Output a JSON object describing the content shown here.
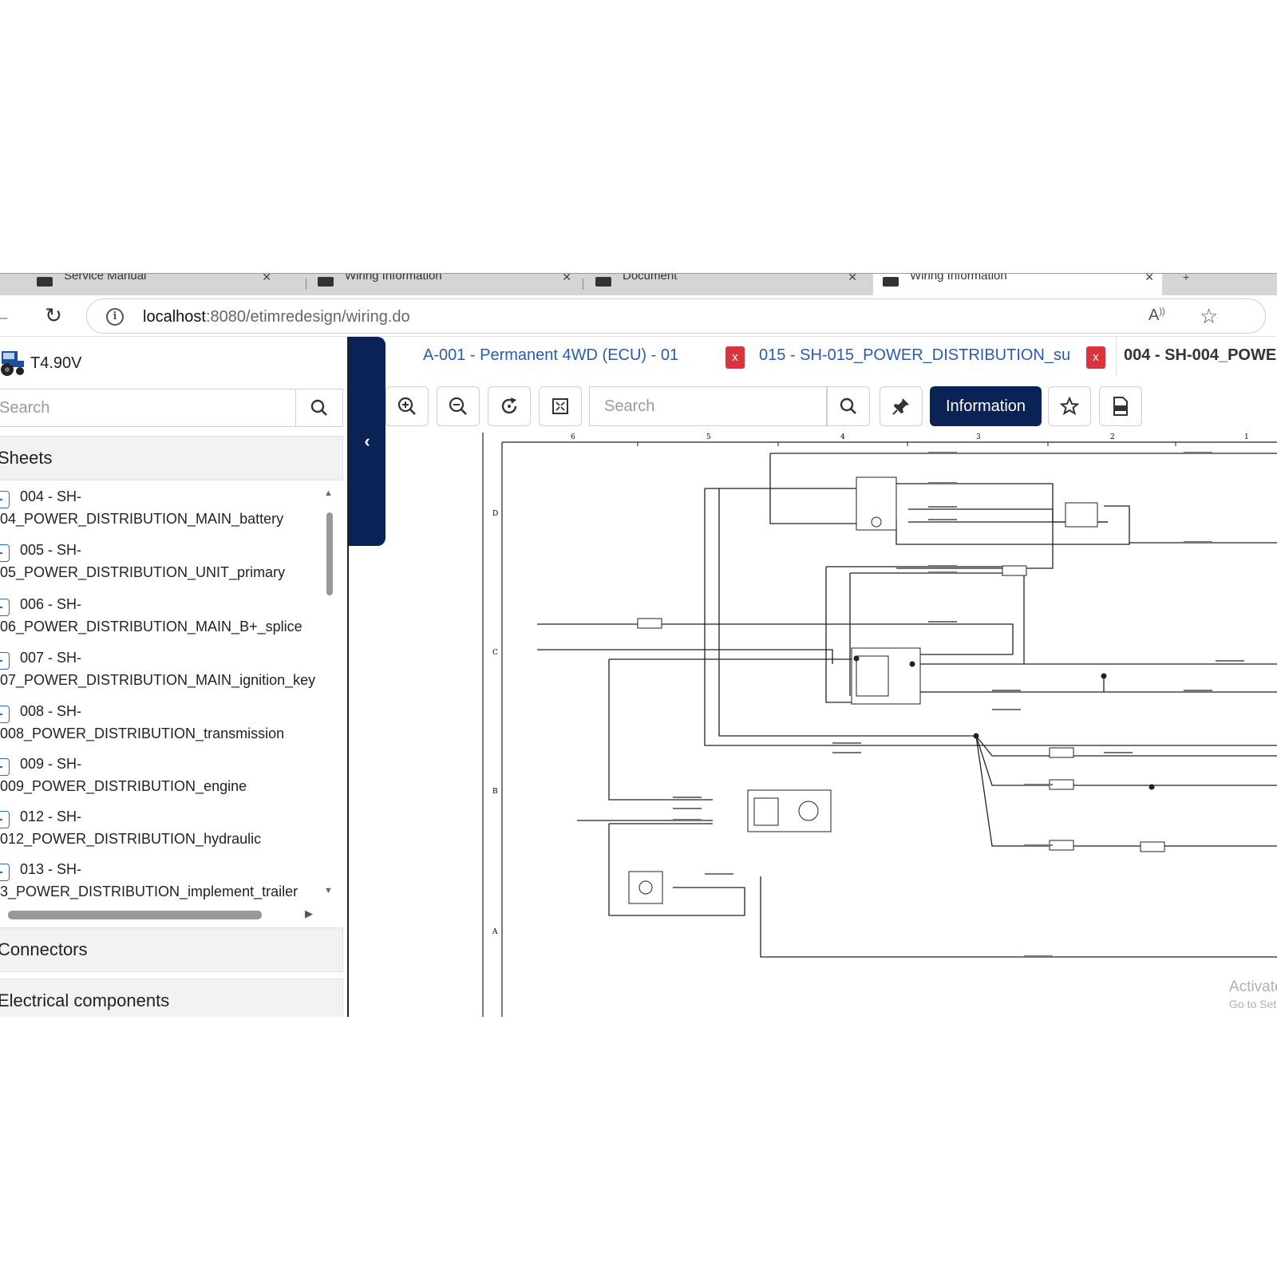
{
  "browser": {
    "tabs": [
      {
        "label": "Service Manual"
      },
      {
        "label": "Wiring Information"
      },
      {
        "label": "Document"
      },
      {
        "label": "Wiring Information"
      }
    ],
    "url_host": "localhost",
    "url_rest": ":8080/etimredesign/wiring.do"
  },
  "left": {
    "model": "T4.90V",
    "search_placeholder": "Search",
    "sheets_header": "Sheets",
    "sheets": [
      {
        "l1": "004 - SH-",
        "l2": "04_POWER_DISTRIBUTION_MAIN_battery"
      },
      {
        "l1": "005 - SH-",
        "l2": "05_POWER_DISTRIBUTION_UNIT_primary"
      },
      {
        "l1": "006 - SH-",
        "l2": "06_POWER_DISTRIBUTION_MAIN_B+_splice"
      },
      {
        "l1": "007 - SH-",
        "l2": "07_POWER_DISTRIBUTION_MAIN_ignition_key"
      },
      {
        "l1": "008 - SH-",
        "l2": "008_POWER_DISTRIBUTION_transmission"
      },
      {
        "l1": "009 - SH-",
        "l2": "009_POWER_DISTRIBUTION_engine"
      },
      {
        "l1": "012 - SH-",
        "l2": "012_POWER_DISTRIBUTION_hydraulic"
      },
      {
        "l1": "013 - SH-",
        "l2": "3_POWER_DISTRIBUTION_implement_trailer"
      }
    ],
    "connectors_header": "Connectors",
    "electrical_header": "Electrical components"
  },
  "doc_tabs": {
    "tab1": "A-001 - Permanent 4WD (ECU) - 01",
    "tab2": "015 - SH-015_POWER_DISTRIBUTION_su",
    "tab3": "004 - SH-004_POWE",
    "close_label": "x"
  },
  "toolbar": {
    "search_placeholder": "Search",
    "information_label": "Information"
  },
  "diagram": {
    "col_labels": [
      "6",
      "5",
      "4",
      "3",
      "2",
      "1"
    ],
    "row_labels": [
      "D",
      "C",
      "B",
      "A"
    ]
  },
  "watermark": {
    "line1": "Activate Windows",
    "line2": "Go to Settings to activate Windows."
  },
  "colors": {
    "navy": "#0b2257",
    "close_red": "#d9353c",
    "link_blue": "#2a5bb3"
  }
}
